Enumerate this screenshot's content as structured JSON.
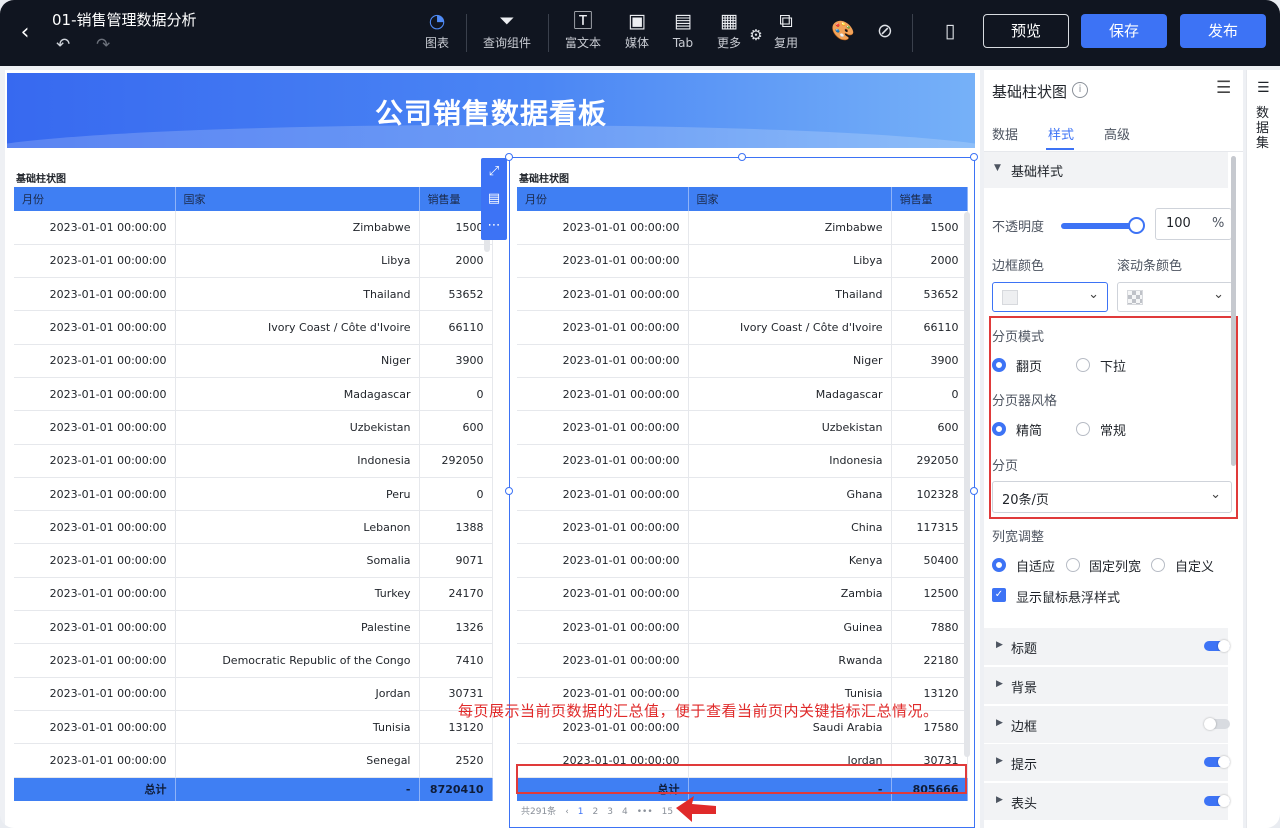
{
  "topbar": {
    "title": "01-销售管理数据分析",
    "tools": [
      {
        "label": "图表",
        "icon": "pie-chart-icon"
      },
      {
        "label": "查询组件",
        "icon": "filter-icon"
      },
      {
        "label": "富文本",
        "icon": "text-icon"
      },
      {
        "label": "媒体",
        "icon": "image-icon"
      },
      {
        "label": "Tab",
        "icon": "tab-icon"
      },
      {
        "label": "更多",
        "icon": "grid-icon"
      },
      {
        "label": "复用",
        "icon": "reuse-icon"
      }
    ],
    "preview": "预览",
    "save": "保存",
    "publish": "发布"
  },
  "canvas": {
    "banner_title": "公司销售数据看板",
    "left_chart": {
      "title": "基础柱状图",
      "columns": [
        "月份",
        "国家",
        "销售量"
      ],
      "rows": [
        [
          "2023-01-01 00:00:00",
          "Zimbabwe",
          "1500"
        ],
        [
          "2023-01-01 00:00:00",
          "Libya",
          "2000"
        ],
        [
          "2023-01-01 00:00:00",
          "Thailand",
          "53652"
        ],
        [
          "2023-01-01 00:00:00",
          "Ivory Coast / Côte d'Ivoire",
          "66110"
        ],
        [
          "2023-01-01 00:00:00",
          "Niger",
          "3900"
        ],
        [
          "2023-01-01 00:00:00",
          "Madagascar",
          "0"
        ],
        [
          "2023-01-01 00:00:00",
          "Uzbekistan",
          "600"
        ],
        [
          "2023-01-01 00:00:00",
          "Indonesia",
          "292050"
        ],
        [
          "2023-01-01 00:00:00",
          "Peru",
          "0"
        ],
        [
          "2023-01-01 00:00:00",
          "Lebanon",
          "1388"
        ],
        [
          "2023-01-01 00:00:00",
          "Somalia",
          "9071"
        ],
        [
          "2023-01-01 00:00:00",
          "Turkey",
          "24170"
        ],
        [
          "2023-01-01 00:00:00",
          "Palestine",
          "1326"
        ],
        [
          "2023-01-01 00:00:00",
          "Democratic Republic of the Congo",
          "7410"
        ],
        [
          "2023-01-01 00:00:00",
          "Jordan",
          "30731"
        ],
        [
          "2023-01-01 00:00:00",
          "Tunisia",
          "13120"
        ],
        [
          "2023-01-01 00:00:00",
          "Senegal",
          "2520"
        ]
      ],
      "total": [
        "总计",
        "-",
        "8720410"
      ]
    },
    "right_chart": {
      "title": "基础柱状图",
      "columns": [
        "月份",
        "国家",
        "销售量"
      ],
      "rows": [
        [
          "2023-01-01 00:00:00",
          "Zimbabwe",
          "1500"
        ],
        [
          "2023-01-01 00:00:00",
          "Libya",
          "2000"
        ],
        [
          "2023-01-01 00:00:00",
          "Thailand",
          "53652"
        ],
        [
          "2023-01-01 00:00:00",
          "Ivory Coast / Côte d'Ivoire",
          "66110"
        ],
        [
          "2023-01-01 00:00:00",
          "Niger",
          "3900"
        ],
        [
          "2023-01-01 00:00:00",
          "Madagascar",
          "0"
        ],
        [
          "2023-01-01 00:00:00",
          "Uzbekistan",
          "600"
        ],
        [
          "2023-01-01 00:00:00",
          "Indonesia",
          "292050"
        ],
        [
          "2023-01-01 00:00:00",
          "Ghana",
          "102328"
        ],
        [
          "2023-01-01 00:00:00",
          "China",
          "117315"
        ],
        [
          "2023-01-01 00:00:00",
          "Kenya",
          "50400"
        ],
        [
          "2023-01-01 00:00:00",
          "Zambia",
          "12500"
        ],
        [
          "2023-01-01 00:00:00",
          "Guinea",
          "7880"
        ],
        [
          "2023-01-01 00:00:00",
          "Rwanda",
          "22180"
        ],
        [
          "2023-01-01 00:00:00",
          "Tunisia",
          "13120"
        ],
        [
          "2023-01-01 00:00:00",
          "Saudi Arabia",
          "17580"
        ],
        [
          "2023-01-01 00:00:00",
          "Jordan",
          "30731"
        ]
      ],
      "total": [
        "总计",
        "-",
        "805666"
      ],
      "pager": {
        "count": "共291条",
        "prev": "‹",
        "pages": [
          "1",
          "2",
          "3",
          "4",
          "•••",
          "15"
        ]
      }
    },
    "annotation": "每页展示当前页数据的汇总值，便于查看当前页内关键指标汇总情况。"
  },
  "right_panel": {
    "title": "基础柱状图",
    "tabs": [
      "数据",
      "样式",
      "高级"
    ],
    "active_tab": "样式",
    "basic_section": "基础样式",
    "opacity_label": "不透明度",
    "opacity_value": "100",
    "opacity_unit": "%",
    "opacity_level": 1.0,
    "border_color_label": "边框颜色",
    "scrollbar_color_label": "滚动条颜色",
    "pagination_mode_label": "分页模式",
    "pagination_modes": [
      "翻页",
      "下拉"
    ],
    "pager_style_label": "分页器风格",
    "pager_styles": [
      "精简",
      "常规"
    ],
    "page_size_label": "分页",
    "page_size_value": "20条/页",
    "col_width_label": "列宽调整",
    "col_width_options": [
      "自适应",
      "固定列宽",
      "自定义"
    ],
    "hover_style_label": "显示鼠标悬浮样式",
    "sections": [
      {
        "label": "标题",
        "toggle": "on"
      },
      {
        "label": "背景",
        "toggle": ""
      },
      {
        "label": "边框",
        "toggle": "off"
      },
      {
        "label": "提示",
        "toggle": "on"
      },
      {
        "label": "表头",
        "toggle": "on"
      }
    ]
  },
  "far_right": {
    "label": "数据集"
  },
  "colors": {
    "accent": "#3d73f5",
    "header_blue": "#3f7ff3",
    "highlight_red": "#e03a3a",
    "topbar": "#101520"
  }
}
